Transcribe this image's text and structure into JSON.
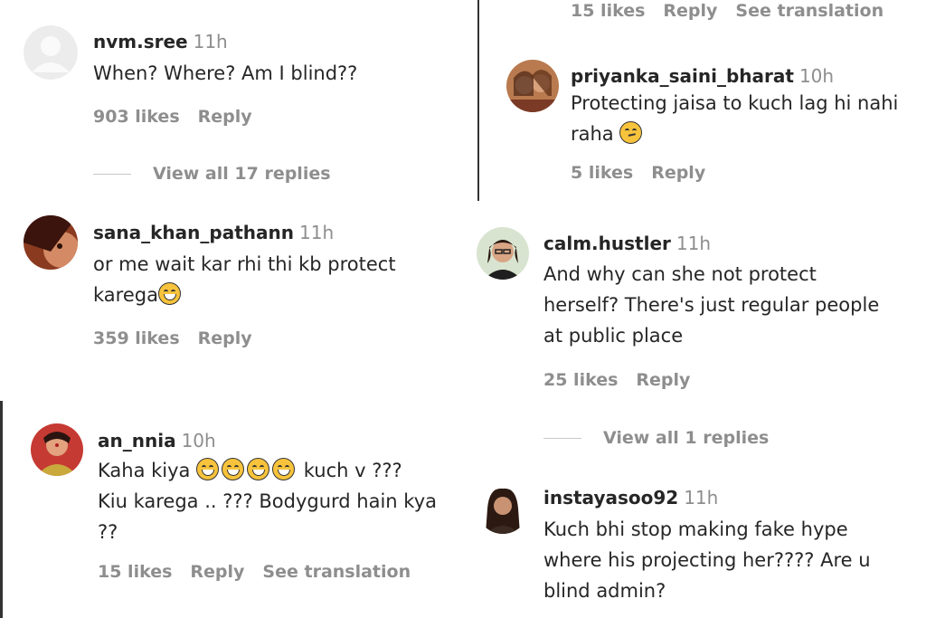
{
  "comments": [
    {
      "user": "nvm.sree",
      "time": "11h",
      "text": "When? Where? Am I blind??",
      "likes": "903 likes",
      "reply": "Reply",
      "view_replies": "View all 17 replies"
    },
    {
      "user": "sana_khan_pathann",
      "time": "11h",
      "text_l1": "or me wait kar rhi thi kb protect",
      "text_l2": "karega",
      "likes": "359 likes",
      "reply": "Reply"
    },
    {
      "user": "an_nnia",
      "time": "10h",
      "text_l1a": "Kaha kiya",
      "text_l1b": "kuch v ???",
      "text_l2": "Kiu karega .. ??? Bodygurd hain kya",
      "text_l3": "??",
      "likes": "15 likes",
      "reply": "Reply",
      "translate": "See translation"
    },
    {
      "likes": "15 likes",
      "reply": "Reply",
      "translate": "See translation"
    },
    {
      "user": "priyanka_saini_bharat",
      "time": "10h",
      "text_l1": "Protecting jaisa to kuch lag hi nahi",
      "text_l2": "raha",
      "likes": "5 likes",
      "reply": "Reply"
    },
    {
      "user": "calm.hustler",
      "time": "11h",
      "text_l1": "And why can she not protect",
      "text_l2": "herself? There's just regular people",
      "text_l3": "at public place",
      "likes": "25 likes",
      "reply": "Reply",
      "view_replies": "View all 1 replies"
    },
    {
      "user": "instayasoo92",
      "time": "11h",
      "text_l1": "Kuch bhi stop making fake hype",
      "text_l2": "where his projecting her???? Are u",
      "text_l3": "blind admin?"
    }
  ],
  "emojis": {
    "laugh": "grinning-squinting-face",
    "think": "thinking-face"
  },
  "colors": {
    "text": "#262626",
    "muted": "#8e8e8e"
  }
}
